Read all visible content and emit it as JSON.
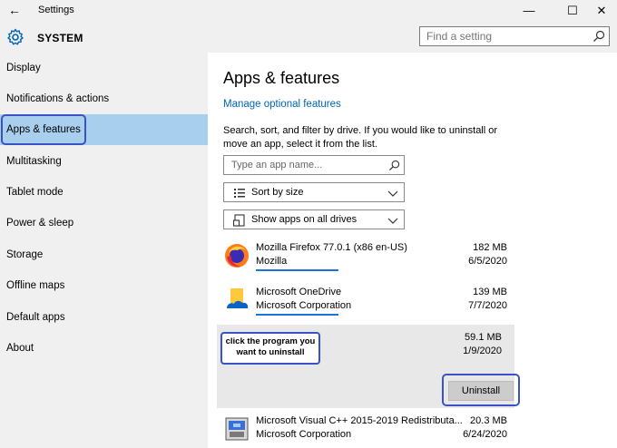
{
  "window": {
    "title": "Settings",
    "back_glyph": "←",
    "min_glyph": "—",
    "max_glyph": "☐",
    "close_glyph": "✕"
  },
  "header": {
    "title": "SYSTEM",
    "search_placeholder": "Find a setting"
  },
  "sidebar": {
    "items": [
      {
        "label": "Display"
      },
      {
        "label": "Notifications & actions"
      },
      {
        "label": "Apps & features"
      },
      {
        "label": "Multitasking"
      },
      {
        "label": "Tablet mode"
      },
      {
        "label": "Power & sleep"
      },
      {
        "label": "Storage"
      },
      {
        "label": "Offline maps"
      },
      {
        "label": "Default apps"
      },
      {
        "label": "About"
      }
    ],
    "active_index": 2
  },
  "main": {
    "title": "Apps & features",
    "link": "Manage optional features",
    "description": "Search, sort, and filter by drive. If you would like to uninstall or move an app, select it from the list.",
    "search_placeholder": "Type an app name...",
    "sort_label": "Sort by size",
    "filter_label": "Show apps on all drives",
    "apps": [
      {
        "name": "Mozilla Firefox 77.0.1 (x86 en-US)",
        "publisher": "Mozilla",
        "size": "182 MB",
        "date": "6/5/2020",
        "icon": "firefox-icon"
      },
      {
        "name": "Microsoft OneDrive",
        "publisher": "Microsoft Corporation",
        "size": "139 MB",
        "date": "7/7/2020",
        "icon": "onedrive-icon"
      },
      {
        "name": "",
        "publisher": "",
        "size": "59.1 MB",
        "date": "1/9/2020",
        "icon": ""
      },
      {
        "name": "Microsoft Visual C++ 2015-2019 Redistributa...",
        "publisher": "Microsoft Corporation",
        "size": "20.3 MB",
        "date": "6/24/2020",
        "icon": "installer-icon"
      }
    ],
    "callout": "click the program you want to uninstall",
    "uninstall_label": "Uninstall"
  },
  "colors": {
    "accent": "#0063b1",
    "highlight": "#3a52c6",
    "nav_active": "#a9cfee",
    "progress": "#1a73d8"
  }
}
